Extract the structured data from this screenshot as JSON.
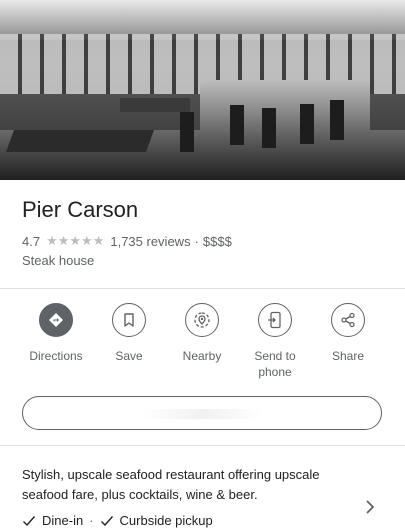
{
  "place": {
    "name": "Pier Carson",
    "rating": "4.7",
    "stars_icon": "★★★★★",
    "reviews": "1,735 reviews",
    "dot": "·",
    "price": "$$$$",
    "category": "Steak house"
  },
  "actions": [
    {
      "label": "Directions",
      "icon": "directions-icon"
    },
    {
      "label": "Save",
      "icon": "bookmark-icon"
    },
    {
      "label": "Nearby",
      "icon": "nearby-icon"
    },
    {
      "label": "Send to\nphone",
      "icon": "send-to-phone-icon"
    },
    {
      "label": "Share",
      "icon": "share-icon"
    }
  ],
  "description": "Stylish, upscale seafood restaurant offering upscale seafood fare, plus cocktails, wine & beer.",
  "features": [
    {
      "label": "Dine-in",
      "icon": "check-icon"
    },
    {
      "label": "Curbside pickup",
      "icon": "check-icon"
    }
  ],
  "features_sep": "·",
  "colors": {
    "icon_gray": "#5f6368",
    "text": "#202124",
    "divider": "#e0e0e0"
  }
}
